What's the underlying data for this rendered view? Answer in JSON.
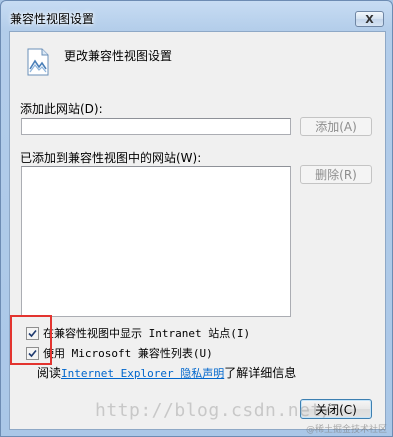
{
  "window": {
    "title": "兼容性视图设置",
    "close_glyph": "X"
  },
  "header": {
    "icon": "compat-view-page-icon",
    "text": "更改兼容性视图设置"
  },
  "add_site": {
    "label": "添加此网站(D):",
    "value": "",
    "button_label": "添加(A)"
  },
  "sites_list": {
    "label": "已添加到兼容性视图中的网站(W):",
    "items": [],
    "remove_button_label": "删除(R)"
  },
  "options": {
    "intranet": {
      "label": "在兼容性视图中显示 Intranet 站点(I)",
      "checked": true
    },
    "ms_list": {
      "label": "使用 Microsoft 兼容性列表(U)",
      "checked": true
    }
  },
  "privacy": {
    "prefix": "阅读 ",
    "link": "Internet Explorer 隐私声明",
    "suffix": "了解详细信息"
  },
  "footer": {
    "close_label": "关闭(C)"
  },
  "watermark": {
    "url": "http://blog.csdn.net/",
    "tag": "@稀土掘金技术社区"
  },
  "colors": {
    "highlight_border": "#e3342f",
    "link": "#0066cc"
  }
}
